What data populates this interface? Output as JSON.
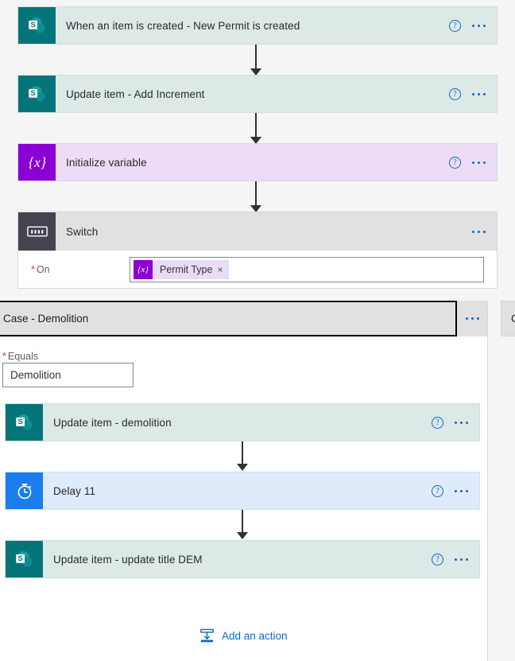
{
  "theme": {
    "canvas_bg": "#f5f5f5",
    "panel_bg": "#ffffff",
    "accent_link": "#1268c3",
    "sharepoint_tile": "#06757a",
    "sharepoint_card": "#dce9e7",
    "variable_tile": "#8a00d4",
    "variable_card": "#ecdcf7",
    "switch_tile": "#44444f",
    "switch_card": "#e1e1e1",
    "delay_tile": "#1b7ced",
    "delay_card": "#dfeafb",
    "required_star": "#d13438",
    "selected_outline": "#000000"
  },
  "flow": {
    "steps": [
      {
        "title": "When an item is created - New Permit is created",
        "icon": "sharepoint-icon",
        "kind": "sharepoint",
        "help_label": "?",
        "menu_label": "More commands"
      },
      {
        "title": "Update item - Add Increment",
        "icon": "sharepoint-icon",
        "kind": "sharepoint",
        "help_label": "?",
        "menu_label": "More commands"
      },
      {
        "title": "Initialize variable",
        "icon": "variable-braces-icon",
        "kind": "variable",
        "help_label": "?",
        "menu_label": "More commands"
      }
    ],
    "switch": {
      "title": "Switch",
      "icon": "switch-control-icon",
      "menu_label": "More commands",
      "on_field": {
        "label": "On",
        "required_marker": "*",
        "token": {
          "icon_glyph": "{x}",
          "label": "Permit Type",
          "remove_glyph": "×"
        }
      }
    },
    "case": {
      "title": "Case - Demolition",
      "menu_label": "More commands",
      "equals_field": {
        "label": "Equals",
        "required_marker": "*",
        "value": "Demolition"
      },
      "actions": [
        {
          "title": "Update item - demolition",
          "icon": "sharepoint-icon",
          "kind": "sharepoint",
          "help_label": "?",
          "menu_label": "More commands"
        },
        {
          "title": "Delay 11",
          "icon": "clock-icon",
          "kind": "delay",
          "help_label": "?",
          "menu_label": "More commands"
        },
        {
          "title": "Update item - update title DEM",
          "icon": "sharepoint-icon",
          "kind": "sharepoint",
          "help_label": "?",
          "menu_label": "More commands"
        }
      ],
      "add_action_label": "Add an action"
    },
    "next_case": {
      "title": "C"
    }
  }
}
